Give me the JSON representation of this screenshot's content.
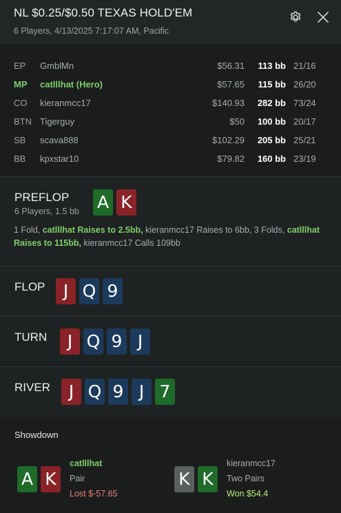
{
  "header": {
    "title": "NL $0.25/$0.50 TEXAS HOLD'EM",
    "subtitle": "6 Players, 4/13/2025 7:17:07 AM, Pacific",
    "gear_icon": "gear-icon",
    "close_icon": "close-icon"
  },
  "players": [
    {
      "pos": "EP",
      "name": "GmblMn",
      "stack": "$56.31",
      "bb": "113 bb",
      "stats": "21/16",
      "hero": false
    },
    {
      "pos": "MP",
      "name": "catlllhat (Hero)",
      "stack": "$57.65",
      "bb": "115 bb",
      "stats": "26/20",
      "hero": true
    },
    {
      "pos": "CO",
      "name": "kieranmcc17",
      "stack": "$140.93",
      "bb": "282 bb",
      "stats": "73/24",
      "hero": false
    },
    {
      "pos": "BTN",
      "name": "Tigerguy",
      "stack": "$50",
      "bb": "100 bb",
      "stats": "20/17",
      "hero": false
    },
    {
      "pos": "SB",
      "name": "scava888",
      "stack": "$102.29",
      "bb": "205 bb",
      "stats": "25/21",
      "hero": false
    },
    {
      "pos": "BB",
      "name": "kpxstar10",
      "stack": "$79.82",
      "bb": "160 bb",
      "stats": "23/19",
      "hero": false
    }
  ],
  "preflop": {
    "label": "PREFLOP",
    "sub": "6 Players, 1.5 bb",
    "cards": [
      {
        "rank": "A",
        "color": "green"
      },
      {
        "rank": "K",
        "color": "red"
      }
    ],
    "actions": [
      {
        "text": "1 Fold, ",
        "hl": false
      },
      {
        "text": "catlllhat Raises to 2.5bb,",
        "hl": true
      },
      {
        "text": " kieranmcc17 Raises to 6bb, 3 Folds, ",
        "hl": false
      },
      {
        "text": "catlllhat Raises to 115bb,",
        "hl": true
      },
      {
        "text": " kieranmcc17 Calls 109bb",
        "hl": false
      }
    ]
  },
  "flop": {
    "label": "FLOP",
    "cards": [
      {
        "rank": "J",
        "color": "red"
      },
      {
        "rank": "Q",
        "color": "blue"
      },
      {
        "rank": "9",
        "color": "blue"
      }
    ]
  },
  "turn": {
    "label": "TURN",
    "cards": [
      {
        "rank": "J",
        "color": "red"
      },
      {
        "rank": "Q",
        "color": "blue"
      },
      {
        "rank": "9",
        "color": "blue"
      },
      {
        "rank": "J",
        "color": "blue"
      }
    ]
  },
  "river": {
    "label": "RIVER",
    "cards": [
      {
        "rank": "J",
        "color": "red"
      },
      {
        "rank": "Q",
        "color": "blue"
      },
      {
        "rank": "9",
        "color": "blue"
      },
      {
        "rank": "J",
        "color": "blue"
      },
      {
        "rank": "7",
        "color": "green"
      }
    ]
  },
  "showdown": {
    "title": "Showdown",
    "hands": [
      {
        "name": "catlllhat",
        "hand": "Pair",
        "result": "Lost $-57.65",
        "outcome": "lost",
        "cards": [
          {
            "rank": "A",
            "color": "green"
          },
          {
            "rank": "K",
            "color": "red"
          }
        ]
      },
      {
        "name": "kieranmcc17",
        "hand": "Two Pairs",
        "result": "Won $54.4",
        "outcome": "won",
        "cards": [
          {
            "rank": "K",
            "color": "gray"
          },
          {
            "rank": "K",
            "color": "green"
          }
        ]
      }
    ]
  },
  "colors": {
    "card_green": "#1f6b2a",
    "card_red": "#8a2327",
    "card_blue": "#1c3a5c",
    "card_gray": "#5a5e5e",
    "hero_green": "#7fce6a",
    "lost_red": "#e8827a",
    "won_green": "#b8f07a"
  }
}
